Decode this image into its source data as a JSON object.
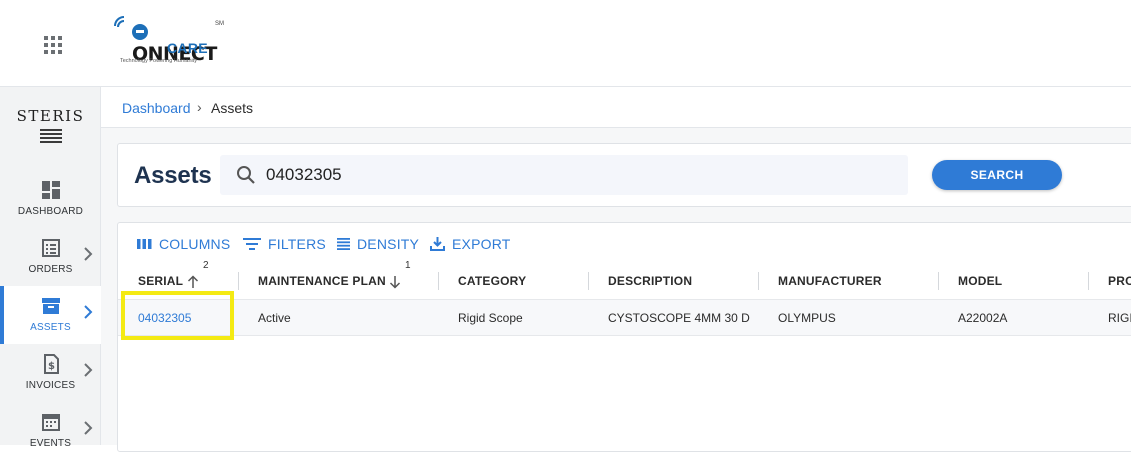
{
  "header": {
    "apps_icon": "apps-grid-icon",
    "logo": {
      "line1": "ONNECT",
      "line2": "CARE",
      "tagline": "Technology Powering Humanity",
      "sm": "SM"
    }
  },
  "sidebar": {
    "brand": "STERIS",
    "items": [
      {
        "label": "DASHBOARD",
        "icon": "dashboard-icon"
      },
      {
        "label": "ORDERS",
        "icon": "orders-list-icon"
      },
      {
        "label": "ASSETS",
        "icon": "assets-box-icon",
        "active": true
      },
      {
        "label": "INVOICES",
        "icon": "invoice-dollar-icon"
      },
      {
        "label": "EVENTS",
        "icon": "calendar-icon"
      }
    ]
  },
  "breadcrumb": {
    "parent": "Dashboard",
    "separator": "›",
    "current": "Assets"
  },
  "search": {
    "title": "Assets",
    "value": "04032305",
    "button": "SEARCH"
  },
  "toolbar": {
    "columns": "COLUMNS",
    "filters": "FILTERS",
    "density": "DENSITY",
    "export": "EXPORT"
  },
  "table": {
    "columns": [
      "SERIAL",
      "MAINTENANCE PLAN",
      "CATEGORY",
      "DESCRIPTION",
      "MANUFACTURER",
      "MODEL",
      "PRO"
    ],
    "sort": {
      "serial_order": "2",
      "plan_order": "1"
    },
    "rows": [
      [
        "04032305",
        "Active",
        "Rigid Scope",
        "CYSTOSCOPE 4MM 30 D",
        "OLYMPUS",
        "A22002A",
        "RIGI"
      ]
    ]
  },
  "colors": {
    "accent": "#2f7bd6",
    "title": "#1e3350",
    "highlight": "#f4ea13"
  }
}
